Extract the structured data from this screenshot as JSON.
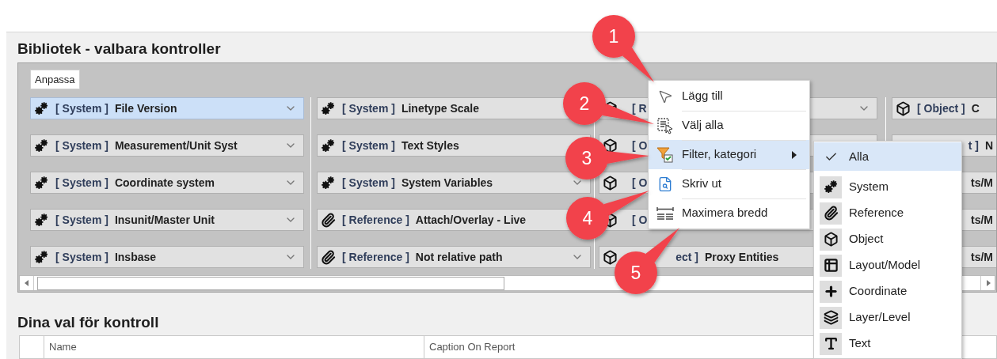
{
  "library": {
    "title": "Bibliotek - valbara kontroller",
    "tab": {
      "label": "Anpassa",
      "selected": true
    },
    "columns": [
      {
        "cards": [
          {
            "kind": "system",
            "category": "[ System ]",
            "name": "File Version",
            "selected": true,
            "chevron": true
          },
          {
            "kind": "system",
            "category": "[ System ]",
            "name": "Measurement/Unit Syst",
            "selected": false,
            "chevron": true
          },
          {
            "kind": "system",
            "category": "[ System ]",
            "name": "Coordinate system",
            "selected": false,
            "chevron": true
          },
          {
            "kind": "system",
            "category": "[ System ]",
            "name": "Insunit/Master Unit",
            "selected": false,
            "chevron": true
          },
          {
            "kind": "system",
            "category": "[ System ]",
            "name": "Insbase",
            "selected": false,
            "chevron": true
          }
        ]
      },
      {
        "cards": [
          {
            "kind": "system",
            "category": "[ System ]",
            "name": "Linetype Scale",
            "selected": false,
            "chevron": false
          },
          {
            "kind": "system",
            "category": "[ System ]",
            "name": "Text Styles",
            "selected": false,
            "chevron": false
          },
          {
            "kind": "system",
            "category": "[ System ]",
            "name": "System Variables",
            "selected": false,
            "chevron": true
          },
          {
            "kind": "reference",
            "category": "[ Reference ]",
            "name": "Attach/Overlay - Live",
            "selected": false,
            "chevron": false
          },
          {
            "kind": "reference",
            "category": "[ Reference ]",
            "name": "Not relative path",
            "selected": false,
            "chevron": true
          }
        ]
      },
      {
        "cards": [
          {
            "kind": "object",
            "category": "[ R",
            "selected": false,
            "chevron": true
          },
          {
            "kind": "object",
            "category": "[ O",
            "selected": false,
            "chevron": false
          },
          {
            "kind": "object",
            "category": "[ O",
            "selected": false,
            "chevron": false
          },
          {
            "kind": "object",
            "category": "[ O",
            "selected": false,
            "chevron": false
          },
          {
            "kind": "object",
            "category": "ect ]",
            "name": "Proxy Entities",
            "selected": false,
            "chevron": false
          }
        ]
      },
      {
        "cards": [
          {
            "kind": "object",
            "category": "[ Object ]",
            "name": "C",
            "selected": false,
            "chevron": false
          },
          {
            "category": "t ]",
            "name": "N",
            "selected": false,
            "chevron": false
          },
          {
            "name": "ts/M",
            "selected": false,
            "chevron": false
          },
          {
            "name": "ts/M",
            "selected": false,
            "chevron": false
          },
          {
            "name": "ts/M",
            "selected": false,
            "chevron": false
          }
        ]
      }
    ]
  },
  "context_menu": {
    "items": [
      {
        "kind": "pointer",
        "label": "Lägg till",
        "selected": false,
        "submenu": false
      },
      {
        "kind": "select-all",
        "label": "Välj alla",
        "selected": false,
        "submenu": false
      },
      {
        "kind": "filter",
        "label": "Filter, kategori",
        "selected": true,
        "submenu": true
      },
      {
        "kind": "print-preview",
        "label": "Skriv ut",
        "selected": false,
        "submenu": false
      },
      {
        "kind": "max-width",
        "label": "Maximera bredd",
        "selected": false,
        "submenu": false
      }
    ]
  },
  "submenu": {
    "items": [
      {
        "label": "Alla",
        "checked": true,
        "selected": true
      },
      {
        "kind": "system",
        "label": "System",
        "checked": false,
        "selected": false
      },
      {
        "kind": "reference",
        "label": "Reference",
        "checked": false,
        "selected": false
      },
      {
        "kind": "object",
        "label": "Object",
        "checked": false,
        "selected": false
      },
      {
        "kind": "layout",
        "label": "Layout/Model",
        "checked": false,
        "selected": false
      },
      {
        "kind": "coordinate",
        "label": "Coordinate",
        "checked": false,
        "selected": false
      },
      {
        "kind": "layer",
        "label": "Layer/Level",
        "checked": false,
        "selected": false
      },
      {
        "kind": "text",
        "label": "Text",
        "checked": false,
        "selected": false
      }
    ]
  },
  "callouts": [
    "1",
    "2",
    "3",
    "4",
    "5"
  ],
  "selection": {
    "title": "Dina val för kontroll",
    "columns": [
      "Name",
      "Caption On Report"
    ]
  }
}
